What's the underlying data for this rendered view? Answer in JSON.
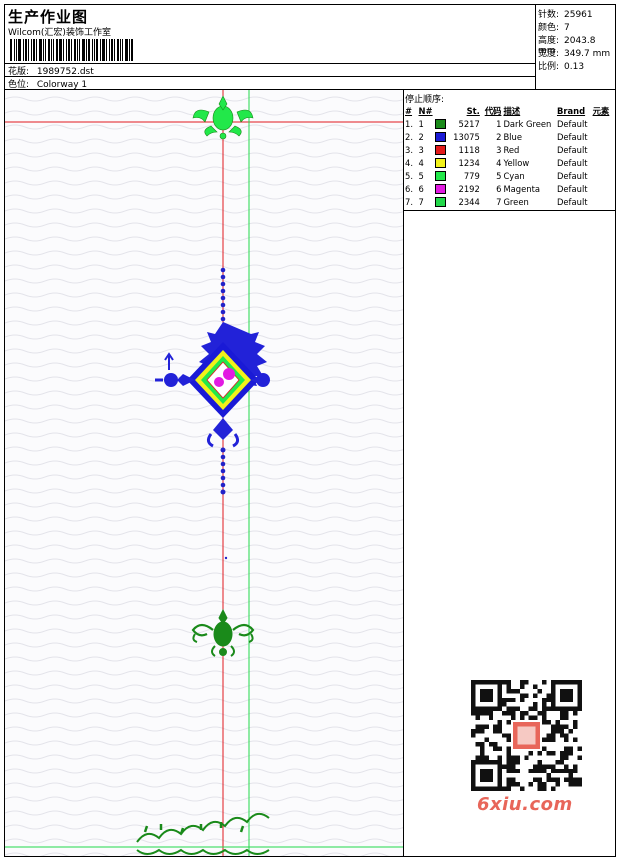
{
  "header": {
    "title": "生产作业图",
    "company": "Wilcom(汇宏)装饰工作室",
    "pattern_label": "花版:",
    "pattern_value": "1989752.dst",
    "colorway_label": "色位:",
    "colorway_value": "Colorway 1"
  },
  "stats": {
    "stitches_label": "针数:",
    "stitches_value": "25961",
    "colors_label": "颜色:",
    "colors_value": "7",
    "height_label": "高度:",
    "height_value": "2043.8 mm",
    "width_label": "宽度:",
    "width_value": "349.7 mm",
    "scale_label": "比例:",
    "scale_value": "0.13"
  },
  "color_table": {
    "stop_title": "停止顺序:",
    "headers": [
      "#",
      "N#",
      "St.",
      "代码",
      "描述",
      "Brand",
      "元素"
    ],
    "rows": [
      {
        "idx": "1.",
        "n": "1",
        "color": "#1a8a1a",
        "st": "5217",
        "code": "1",
        "desc": "Dark Green",
        "brand": "Default"
      },
      {
        "idx": "2.",
        "n": "2",
        "color": "#1a1ad6",
        "st": "13075",
        "code": "2",
        "desc": "Blue",
        "brand": "Default"
      },
      {
        "idx": "3.",
        "n": "3",
        "color": "#e21a1a",
        "st": "1118",
        "code": "3",
        "desc": "Red",
        "brand": "Default"
      },
      {
        "idx": "4.",
        "n": "4",
        "color": "#f2f21a",
        "st": "1234",
        "code": "4",
        "desc": "Yellow",
        "brand": "Default"
      },
      {
        "idx": "5.",
        "n": "5",
        "color": "#22e84a",
        "st": "779",
        "code": "5",
        "desc": "Cyan",
        "brand": "Default"
      },
      {
        "idx": "6.",
        "n": "6",
        "color": "#e21ae2",
        "st": "2192",
        "code": "6",
        "desc": "Magenta",
        "brand": "Default"
      },
      {
        "idx": "7.",
        "n": "7",
        "color": "#22d84a",
        "st": "2344",
        "code": "7",
        "desc": "Green",
        "brand": "Default"
      }
    ]
  },
  "watermark": {
    "brand_text": "6xiu.com",
    "brand_color": "#e8665a",
    "qr_icon": "qr-code-icon"
  }
}
